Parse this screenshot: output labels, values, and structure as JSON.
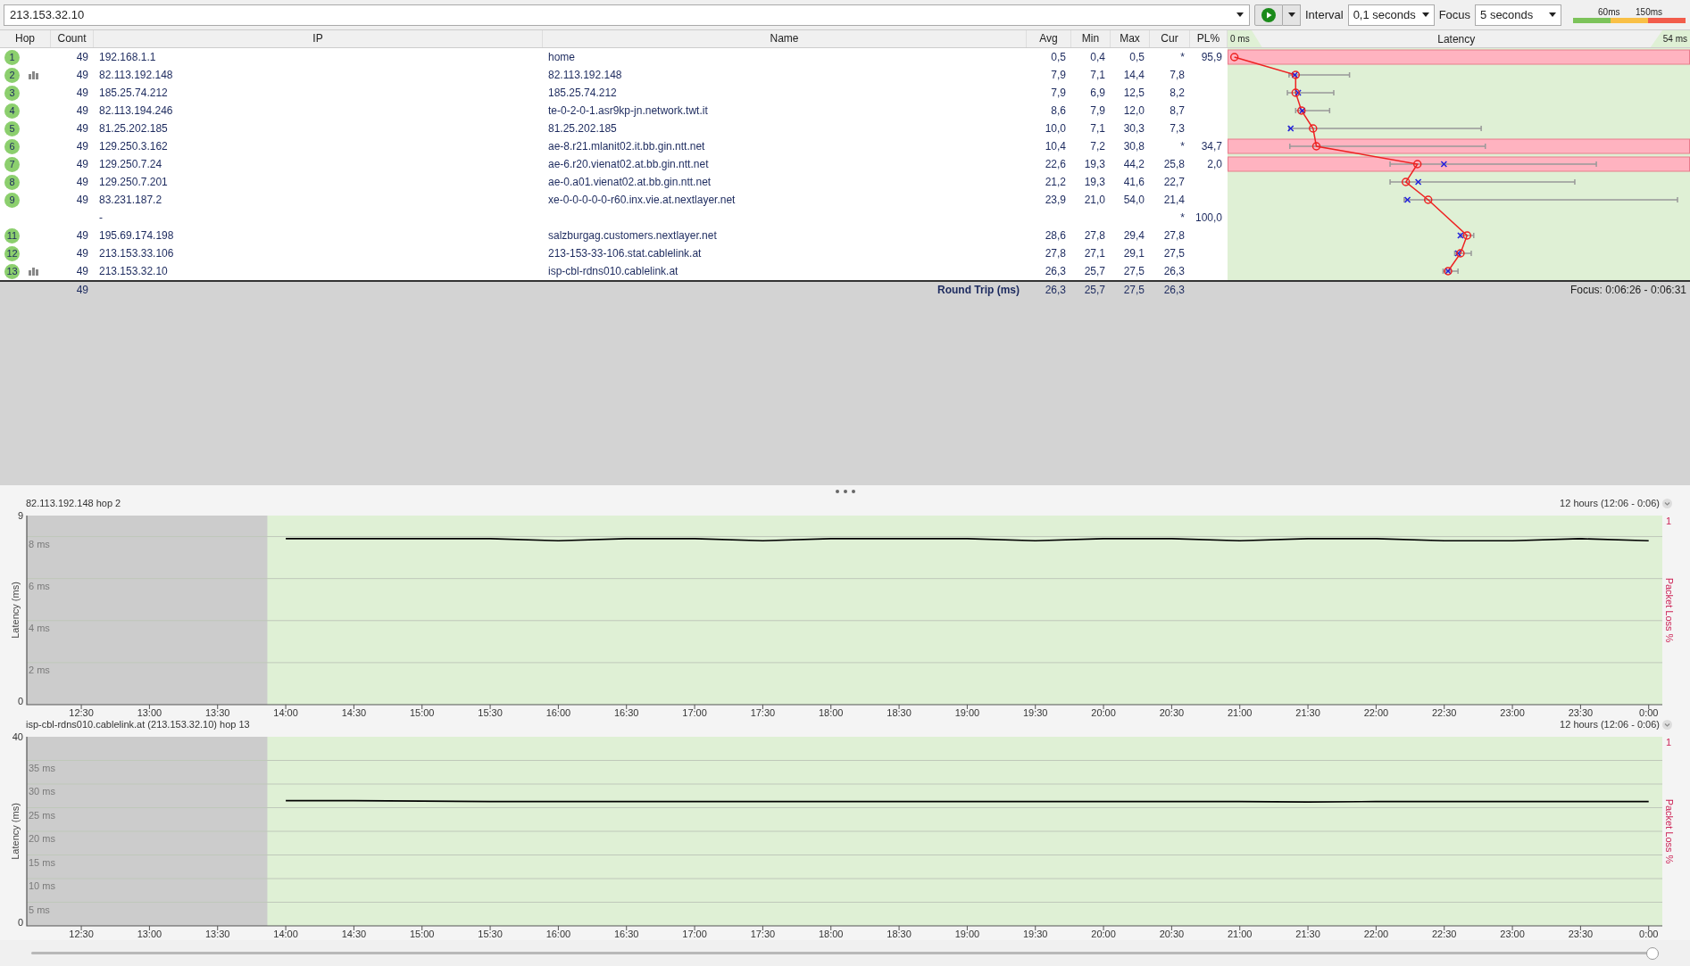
{
  "toolbar": {
    "host": "213.153.32.10",
    "interval_label": "Interval",
    "interval": "0,1 seconds",
    "focus_label": "Focus",
    "focus": "5 seconds",
    "legend": [
      {
        "color": "#7cc35a"
      },
      {
        "label": "60ms",
        "color": "#f9c046"
      },
      {
        "label": "150ms",
        "color": "#f25c4b"
      }
    ]
  },
  "table": {
    "columns": [
      "Hop",
      "Count",
      "IP",
      "Name",
      "Avg",
      "Min",
      "Max",
      "Cur",
      "PL%"
    ],
    "latency_header": {
      "title": "Latency",
      "min_label": "0 ms",
      "max_label": "54 ms"
    },
    "rows": [
      {
        "hop": "1",
        "graph": false,
        "count": "49",
        "ip": "192.168.1.1",
        "name": "home",
        "avg": "0,5",
        "min": "0,4",
        "max": "0,5",
        "cur": "*",
        "pl": "95,9",
        "alert": true
      },
      {
        "hop": "2",
        "graph": true,
        "count": "49",
        "ip": "82.113.192.148",
        "name": "82.113.192.148",
        "avg": "7,9",
        "min": "7,1",
        "max": "14,4",
        "cur": "7,8",
        "alert": false
      },
      {
        "hop": "3",
        "graph": false,
        "count": "49",
        "ip": "185.25.74.212",
        "name": "185.25.74.212",
        "avg": "7,9",
        "min": "6,9",
        "max": "12,5",
        "cur": "8,2",
        "alert": false
      },
      {
        "hop": "4",
        "graph": false,
        "count": "49",
        "ip": "82.113.194.246",
        "name": "te-0-2-0-1.asr9kp-jn.network.twt.it",
        "avg": "8,6",
        "min": "7,9",
        "max": "12,0",
        "cur": "8,7",
        "alert": false
      },
      {
        "hop": "5",
        "graph": false,
        "count": "49",
        "ip": "81.25.202.185",
        "name": "81.25.202.185",
        "avg": "10,0",
        "min": "7,1",
        "max": "30,3",
        "cur": "7,3",
        "alert": false
      },
      {
        "hop": "6",
        "graph": false,
        "count": "49",
        "ip": "129.250.3.162",
        "name": "ae-8.r21.mlanit02.it.bb.gin.ntt.net",
        "avg": "10,4",
        "min": "7,2",
        "max": "30,8",
        "cur": "*",
        "pl": "34,7",
        "alert": true
      },
      {
        "hop": "7",
        "graph": false,
        "count": "49",
        "ip": "129.250.7.24",
        "name": "ae-6.r20.vienat02.at.bb.gin.ntt.net",
        "avg": "22,6",
        "min": "19,3",
        "max": "44,2",
        "cur": "25,8",
        "pl": "2,0",
        "alert": true
      },
      {
        "hop": "8",
        "graph": false,
        "count": "49",
        "ip": "129.250.7.201",
        "name": "ae-0.a01.vienat02.at.bb.gin.ntt.net",
        "avg": "21,2",
        "min": "19,3",
        "max": "41,6",
        "cur": "22,7",
        "alert": false
      },
      {
        "hop": "9",
        "graph": false,
        "count": "49",
        "ip": "83.231.187.2",
        "name": "xe-0-0-0-0-0-r60.inx.vie.at.nextlayer.net",
        "avg": "23,9",
        "min": "21,0",
        "max": "54,0",
        "cur": "21,4",
        "alert": false
      },
      {
        "graph": false,
        "ip": "-",
        "cur": "*",
        "pl": "100,0",
        "alert": false
      },
      {
        "hop": "11",
        "graph": false,
        "count": "49",
        "ip": "195.69.174.198",
        "name": "salzburgag.customers.nextlayer.net",
        "avg": "28,6",
        "min": "27,8",
        "max": "29,4",
        "cur": "27,8",
        "alert": false
      },
      {
        "hop": "12",
        "graph": false,
        "count": "49",
        "ip": "213.153.33.106",
        "name": "213-153-33-106.stat.cablelink.at",
        "avg": "27,8",
        "min": "27,1",
        "max": "29,1",
        "cur": "27,5",
        "alert": false
      },
      {
        "hop": "13",
        "graph": true,
        "count": "49",
        "ip": "213.153.32.10",
        "name": "isp-cbl-rdns010.cablelink.at",
        "avg": "26,3",
        "min": "25,7",
        "max": "27,5",
        "cur": "26,3",
        "alert": false
      }
    ],
    "footer": {
      "count": "49",
      "label": "Round Trip (ms)",
      "avg": "26,3",
      "min": "25,7",
      "max": "27,5",
      "cur": "26,3",
      "focus": "Focus: 0:06:26 - 0:06:31"
    }
  },
  "charts": [
    {
      "range": "12 hours (12:06 - 0:06)",
      "y_top_label": "9",
      "y_bottom_label": "0",
      "loss_max": "1",
      "loss_label": "Packet Loss %",
      "chart_data": {
        "type": "line",
        "title": "82.113.192.148 hop 2",
        "ylabel": "Latency (ms)",
        "categories": [
          "12:30",
          "13:00",
          "13:30",
          "14:00",
          "14:30",
          "15:00",
          "15:30",
          "16:00",
          "16:30",
          "17:00",
          "17:30",
          "18:00",
          "18:30",
          "19:00",
          "19:30",
          "20:00",
          "20:30",
          "21:00",
          "21:30",
          "22:00",
          "22:30",
          "23:00",
          "23:30",
          "0:00"
        ],
        "series": [
          {
            "color": "#000000",
            "values": [
              null,
              null,
              null,
              7.9,
              7.9,
              7.9,
              7.9,
              7.8,
              7.9,
              7.9,
              7.8,
              7.9,
              7.9,
              7.9,
              7.8,
              7.9,
              7.9,
              7.8,
              7.9,
              7.9,
              7.8,
              7.8,
              7.9,
              7.8
            ]
          }
        ],
        "ylim": [
          0,
          9
        ],
        "grid": true,
        "yticks": [
          {
            "value": 2,
            "label": "2 ms"
          },
          {
            "value": 4,
            "label": "4 ms"
          },
          {
            "value": 6,
            "label": "6 ms"
          },
          {
            "value": 8,
            "label": "8 ms"
          }
        ]
      }
    },
    {
      "range": "12 hours (12:06 - 0:06)",
      "y_top_label": "40",
      "y_bottom_label": "0",
      "loss_max": "1",
      "loss_label": "Packet Loss %",
      "chart_data": {
        "type": "line",
        "title": "isp-cbl-rdns010.cablelink.at (213.153.32.10) hop 13",
        "ylabel": "Latency (ms)",
        "categories": [
          "12:30",
          "13:00",
          "13:30",
          "14:00",
          "14:30",
          "15:00",
          "15:30",
          "16:00",
          "16:30",
          "17:00",
          "17:30",
          "18:00",
          "18:30",
          "19:00",
          "19:30",
          "20:00",
          "20:30",
          "21:00",
          "21:30",
          "22:00",
          "22:30",
          "23:00",
          "23:30",
          "0:00"
        ],
        "series": [
          {
            "color": "#000000",
            "values": [
              null,
              null,
              null,
              26.5,
              26.5,
              26.4,
              26.3,
              26.3,
              26.3,
              26.3,
              26.3,
              26.3,
              26.3,
              26.3,
              26.3,
              26.3,
              26.3,
              26.3,
              26.2,
              26.3,
              26.3,
              26.3,
              26.3,
              26.3
            ]
          }
        ],
        "ylim": [
          0,
          40
        ],
        "grid": true,
        "yticks": [
          {
            "value": 5,
            "label": "5 ms"
          },
          {
            "value": 10,
            "label": "10 ms"
          },
          {
            "value": 15,
            "label": "15 ms"
          },
          {
            "value": 20,
            "label": "20 ms"
          },
          {
            "value": 25,
            "label": "25 ms"
          },
          {
            "value": 30,
            "label": "30 ms"
          },
          {
            "value": 35,
            "label": "35 ms"
          }
        ]
      }
    }
  ],
  "timeline_slider": {
    "level": 1
  }
}
